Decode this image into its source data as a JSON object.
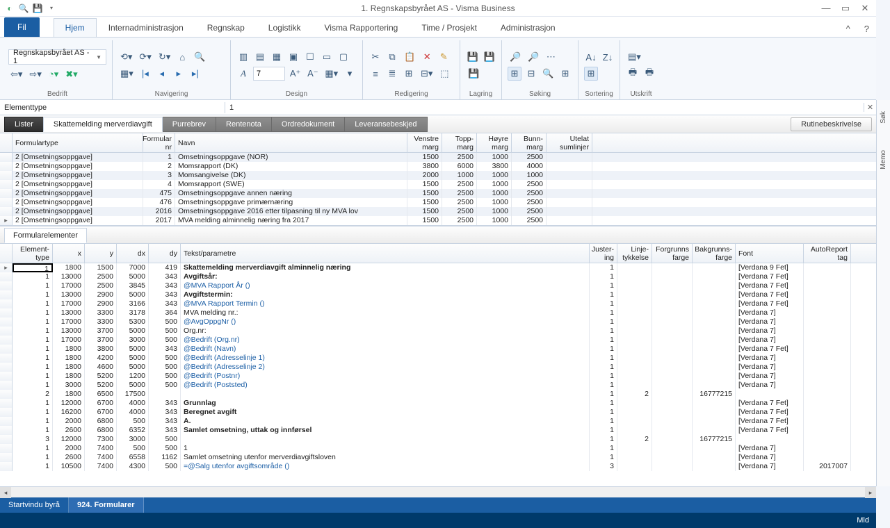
{
  "title": "1. Regnskapsbyrået AS -  Visma Business",
  "qat": {
    "save": "💾",
    "dd": "▾"
  },
  "file_label": "Fil",
  "ribtabs": [
    "Hjem",
    "Internadministrasjon",
    "Regnskap",
    "Logistikk",
    "Visma Rapportering",
    "Time / Prosjekt",
    "Administrasjon"
  ],
  "company_combo": "Regnskapsbyrået AS - 1",
  "groups": {
    "g1": "Bedrift",
    "g2": "Navigering",
    "g3": "Design",
    "g4": "Redigering",
    "g5": "Lagring",
    "g6": "Søking",
    "g7": "Sortering",
    "g8": "Utskrift"
  },
  "design_num": "7",
  "docbar": {
    "label": "Elementtype",
    "value": "1"
  },
  "subtabs": [
    "Lister",
    "Skattemelding merverdiavgift",
    "Purrebrev",
    "Rentenota",
    "Ordredokument",
    "Leveransebeskjed"
  ],
  "rutine_btn": "Rutinebeskrivelse",
  "side": [
    "Søk",
    "Memo"
  ],
  "g1": {
    "cols": [
      "Formulartype",
      "Formular nr",
      "Navn",
      "Venstre marg",
      "Topp- marg",
      "Høyre marg",
      "Bunn- marg",
      "Utelat sumlinjer"
    ],
    "rows": [
      {
        "ft": "2 [Omsetningsoppgave]",
        "fn": "1",
        "nv": "Omsetningsoppgave (NOR)",
        "m": [
          "1500",
          "2500",
          "1000",
          "2500"
        ]
      },
      {
        "ft": "2 [Omsetningsoppgave]",
        "fn": "2",
        "nv": "Momsrapport (DK)",
        "m": [
          "3800",
          "6000",
          "3800",
          "4000"
        ]
      },
      {
        "ft": "2 [Omsetningsoppgave]",
        "fn": "3",
        "nv": "Momsangivelse (DK)",
        "m": [
          "2000",
          "1000",
          "1000",
          "1000"
        ]
      },
      {
        "ft": "2 [Omsetningsoppgave]",
        "fn": "4",
        "nv": "Momsrapport (SWE)",
        "m": [
          "1500",
          "2500",
          "1000",
          "2500"
        ]
      },
      {
        "ft": "2 [Omsetningsoppgave]",
        "fn": "475",
        "nv": "Omsetningsoppgave annen næring",
        "m": [
          "1500",
          "2500",
          "1000",
          "2500"
        ]
      },
      {
        "ft": "2 [Omsetningsoppgave]",
        "fn": "476",
        "nv": "Omsetningsoppgave primærnæring",
        "m": [
          "1500",
          "2500",
          "1000",
          "2500"
        ]
      },
      {
        "ft": "2 [Omsetningsoppgave]",
        "fn": "2016",
        "nv": "Omsetningsoppgave 2016 etter tilpasning til ny MVA lov",
        "m": [
          "1500",
          "2500",
          "1000",
          "2500"
        ]
      },
      {
        "ft": "2 [Omsetningsoppgave]",
        "fn": "2017",
        "nv": "MVA melding alminnelig næring fra 2017",
        "m": [
          "1500",
          "2500",
          "1000",
          "2500"
        ],
        "sel": true
      }
    ]
  },
  "section_label": "Formularelementer",
  "g2": {
    "cols": [
      "Element- type",
      "x",
      "y",
      "dx",
      "dy",
      "Tekst/parametre",
      "Juster- ing",
      "Linje- tykkelse",
      "Forgrunns farge",
      "Bakgrunns- farge",
      "Font",
      "AutoReport tag"
    ],
    "rows": [
      {
        "et": "1",
        "x": "1800",
        "y": "1500",
        "dx": "7000",
        "dy": "419",
        "tp": "Skattemelding merverdiavgift alminnelig næring",
        "ju": "1",
        "ft": "[Verdana 9 Fet]",
        "bold": true,
        "sel": true
      },
      {
        "et": "1",
        "x": "13000",
        "y": "2500",
        "dx": "5000",
        "dy": "343",
        "tp": "Avgiftsår:",
        "ju": "1",
        "ft": "[Verdana 7 Fet]",
        "bold": true
      },
      {
        "et": "1",
        "x": "17000",
        "y": "2500",
        "dx": "3845",
        "dy": "343",
        "tp": "@MVA Rapport År ()",
        "ju": "1",
        "ft": "[Verdana 7 Fet]",
        "link": true
      },
      {
        "et": "1",
        "x": "13000",
        "y": "2900",
        "dx": "5000",
        "dy": "343",
        "tp": "Avgiftstermin:",
        "ju": "1",
        "ft": "[Verdana 7 Fet]",
        "bold": true
      },
      {
        "et": "1",
        "x": "17000",
        "y": "2900",
        "dx": "3166",
        "dy": "343",
        "tp": "@MVA Rapport Termin ()",
        "ju": "1",
        "ft": "[Verdana 7 Fet]",
        "link": true
      },
      {
        "et": "1",
        "x": "13000",
        "y": "3300",
        "dx": "3178",
        "dy": "364",
        "tp": "MVA melding nr.:",
        "ju": "1",
        "ft": "[Verdana 7]"
      },
      {
        "et": "1",
        "x": "17000",
        "y": "3300",
        "dx": "5300",
        "dy": "500",
        "tp": "@AvgOppgNr ()",
        "ju": "1",
        "ft": "[Verdana 7]",
        "link": true
      },
      {
        "et": "1",
        "x": "13000",
        "y": "3700",
        "dx": "5000",
        "dy": "500",
        "tp": "Org.nr:",
        "ju": "1",
        "ft": "[Verdana 7]"
      },
      {
        "et": "1",
        "x": "17000",
        "y": "3700",
        "dx": "3000",
        "dy": "500",
        "tp": "@Bedrift (Org.nr)",
        "ju": "1",
        "ft": "[Verdana 7]",
        "link": true
      },
      {
        "et": "1",
        "x": "1800",
        "y": "3800",
        "dx": "5000",
        "dy": "343",
        "tp": "@Bedrift (Navn)",
        "ju": "1",
        "ft": "[Verdana 7 Fet]",
        "link": true
      },
      {
        "et": "1",
        "x": "1800",
        "y": "4200",
        "dx": "5000",
        "dy": "500",
        "tp": "@Bedrift (Adresselinje 1)",
        "ju": "1",
        "ft": "[Verdana 7]",
        "link": true
      },
      {
        "et": "1",
        "x": "1800",
        "y": "4600",
        "dx": "5000",
        "dy": "500",
        "tp": "@Bedrift (Adresselinje 2)",
        "ju": "1",
        "ft": "[Verdana 7]",
        "link": true
      },
      {
        "et": "1",
        "x": "1800",
        "y": "5200",
        "dx": "1200",
        "dy": "500",
        "tp": "@Bedrift (Postnr)",
        "ju": "1",
        "ft": "[Verdana 7]",
        "link": true
      },
      {
        "et": "1",
        "x": "3000",
        "y": "5200",
        "dx": "5000",
        "dy": "500",
        "tp": "@Bedrift (Poststed)",
        "ju": "1",
        "ft": "[Verdana 7]",
        "link": true
      },
      {
        "et": "2",
        "x": "1800",
        "y": "6500",
        "dx": "17500",
        "dy": "",
        "tp": "",
        "ju": "1",
        "lt": "2",
        "bg": "16777215",
        "ft": ""
      },
      {
        "et": "1",
        "x": "12000",
        "y": "6700",
        "dx": "4000",
        "dy": "343",
        "tp": "Grunnlag",
        "ju": "1",
        "ft": "[Verdana 7 Fet]",
        "bold": true
      },
      {
        "et": "1",
        "x": "16200",
        "y": "6700",
        "dx": "4000",
        "dy": "343",
        "tp": "Beregnet avgift",
        "ju": "1",
        "ft": "[Verdana 7 Fet]",
        "bold": true
      },
      {
        "et": "1",
        "x": "2000",
        "y": "6800",
        "dx": "500",
        "dy": "343",
        "tp": "A.",
        "ju": "1",
        "ft": "[Verdana 7 Fet]",
        "bold": true
      },
      {
        "et": "1",
        "x": "2600",
        "y": "6800",
        "dx": "6352",
        "dy": "343",
        "tp": "Samlet omsetning, uttak og innførsel",
        "ju": "1",
        "ft": "[Verdana 7 Fet]",
        "bold": true
      },
      {
        "et": "3",
        "x": "12000",
        "y": "7300",
        "dx": "3000",
        "dy": "500",
        "tp": "",
        "ju": "1",
        "lt": "2",
        "bg": "16777215",
        "ft": ""
      },
      {
        "et": "1",
        "x": "2000",
        "y": "7400",
        "dx": "500",
        "dy": "500",
        "tp": "1",
        "ju": "1",
        "ft": "[Verdana 7]"
      },
      {
        "et": "1",
        "x": "2600",
        "y": "7400",
        "dx": "6558",
        "dy": "1162",
        "tp": "Samlet omsetning utenfor merverdiavgiftsloven",
        "ju": "1",
        "ft": "[Verdana 7]"
      },
      {
        "et": "1",
        "x": "10500",
        "y": "7400",
        "dx": "4300",
        "dy": "500",
        "tp": "=@Salg utenfor avgiftsområde ()",
        "ju": "3",
        "ft": "[Verdana 7]",
        "ar": "2017007",
        "link": true
      }
    ]
  },
  "wintabs": [
    "Startvindu byrå",
    "924. Formularer"
  ],
  "status": "Mld"
}
